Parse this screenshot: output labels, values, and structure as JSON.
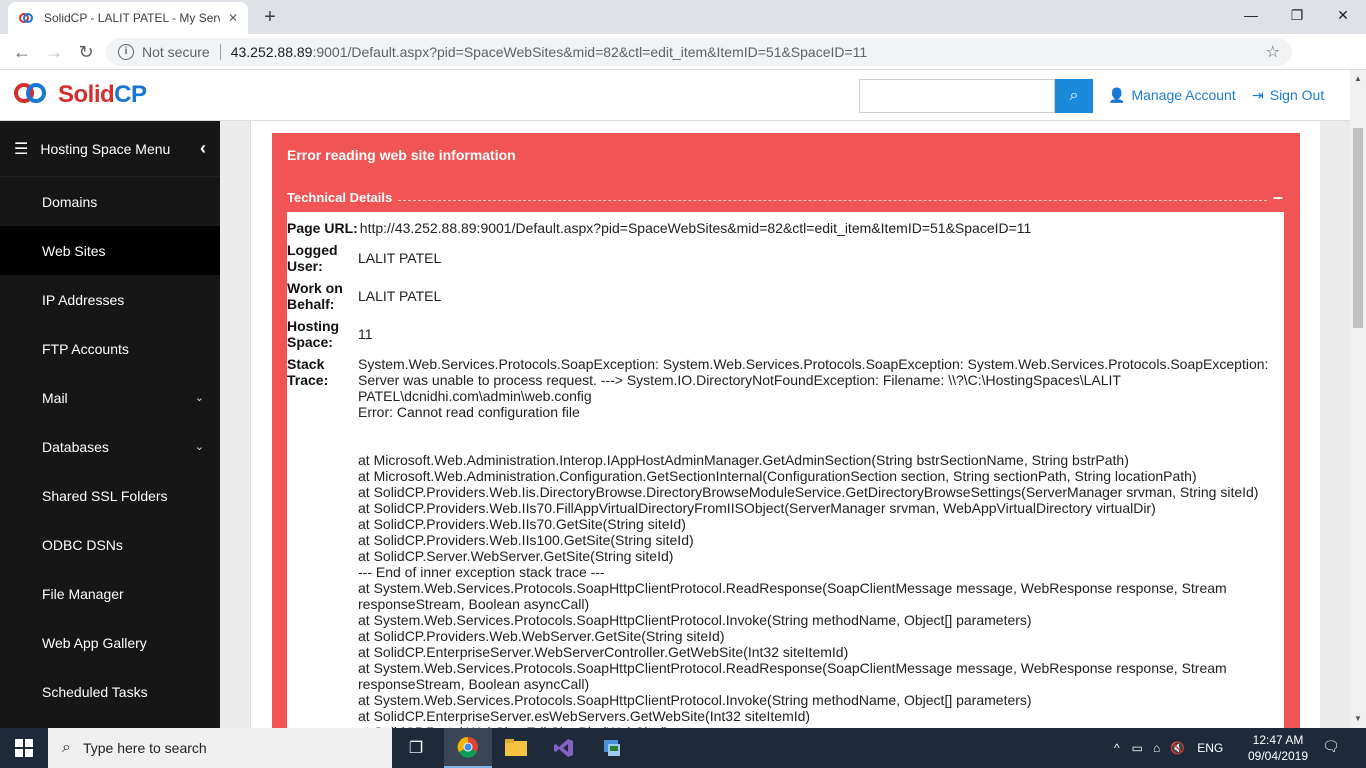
{
  "browser": {
    "tab_title": "SolidCP - LALIT PATEL - My Serve",
    "tab_close": "✕",
    "new_tab": "+",
    "security_label": "Not secure",
    "url_host": "43.252.88.89",
    "url_rest": ":9001/Default.aspx?pid=SpaceWebSites&mid=82&ctl=edit_item&ItemID=51&SpaceID=11",
    "window_controls": [
      "—",
      "❐",
      "✕"
    ]
  },
  "header": {
    "logo_solid": "Solid",
    "logo_cp": "CP",
    "search_placeholder": "",
    "manage_account": "Manage Account",
    "sign_out": "Sign Out"
  },
  "sidebar": {
    "title": "Hosting Space Menu",
    "items": [
      {
        "label": "Domains",
        "active": false,
        "expandable": false
      },
      {
        "label": "Web Sites",
        "active": true,
        "expandable": false
      },
      {
        "label": "IP Addresses",
        "active": false,
        "expandable": false
      },
      {
        "label": "FTP Accounts",
        "active": false,
        "expandable": false
      },
      {
        "label": "Mail",
        "active": false,
        "expandable": true
      },
      {
        "label": "Databases",
        "active": false,
        "expandable": true
      },
      {
        "label": "Shared SSL Folders",
        "active": false,
        "expandable": false
      },
      {
        "label": "ODBC DSNs",
        "active": false,
        "expandable": false
      },
      {
        "label": "File Manager",
        "active": false,
        "expandable": false
      },
      {
        "label": "Web App Gallery",
        "active": false,
        "expandable": false
      },
      {
        "label": "Scheduled Tasks",
        "active": false,
        "expandable": false
      }
    ]
  },
  "error": {
    "title": "Error reading web site information",
    "technical_details": "Technical Details",
    "collapse_symbol": "–",
    "page_url_label": "Page URL:",
    "page_url": "http://43.252.88.89:9001/Default.aspx?pid=SpaceWebSites&mid=82&ctl=edit_item&ItemID=51&SpaceID=11",
    "logged_user_label": "Logged User:",
    "logged_user": "LALIT PATEL",
    "behalf_label": "Work on Behalf:",
    "behalf": "LALIT PATEL",
    "space_label": "Hosting Space:",
    "space": "11",
    "stack_label": "Stack Trace:",
    "stack_trace": "System.Web.Services.Protocols.SoapException: System.Web.Services.Protocols.SoapException: System.Web.Services.Protocols.SoapException: Server was unable to process request. ---> System.IO.DirectoryNotFoundException: Filename: \\\\?\\C:\\HostingSpaces\\LALIT PATEL\\dcnidhi.com\\admin\\web.config\nError: Cannot read configuration file\n\n\nat Microsoft.Web.Administration.Interop.IAppHostAdminManager.GetAdminSection(String bstrSectionName, String bstrPath)\nat Microsoft.Web.Administration.Configuration.GetSectionInternal(ConfigurationSection section, String sectionPath, String locationPath)\nat SolidCP.Providers.Web.Iis.DirectoryBrowse.DirectoryBrowseModuleService.GetDirectoryBrowseSettings(ServerManager srvman, String siteId)\nat SolidCP.Providers.Web.IIs70.FillAppVirtualDirectoryFromIISObject(ServerManager srvman, WebAppVirtualDirectory virtualDir)\nat SolidCP.Providers.Web.IIs70.GetSite(String siteId)\nat SolidCP.Providers.Web.IIs100.GetSite(String siteId)\nat SolidCP.Server.WebServer.GetSite(String siteId)\n--- End of inner exception stack trace ---\nat System.Web.Services.Protocols.SoapHttpClientProtocol.ReadResponse(SoapClientMessage message, WebResponse response, Stream responseStream, Boolean asyncCall)\nat System.Web.Services.Protocols.SoapHttpClientProtocol.Invoke(String methodName, Object[] parameters)\nat SolidCP.Providers.Web.WebServer.GetSite(String siteId)\nat SolidCP.EnterpriseServer.WebServerController.GetWebSite(Int32 siteItemId)\nat System.Web.Services.Protocols.SoapHttpClientProtocol.ReadResponse(SoapClientMessage message, WebResponse response, Stream responseStream, Boolean asyncCall)\nat System.Web.Services.Protocols.SoapHttpClientProtocol.Invoke(String methodName, Object[] parameters)\nat SolidCP.EnterpriseServer.esWebServers.GetWebSite(Int32 siteItemId)\nat SolidCP.Portal.WebSitesEditSite.BindWebSite()"
  },
  "taskbar": {
    "search_placeholder": "Type here to search",
    "language": "ENG",
    "time": "12:47 AM",
    "date": "09/04/2019"
  },
  "colors": {
    "error_bg": "#f05454",
    "accent": "#1c8adb",
    "sidebar_bg": "#161616"
  }
}
